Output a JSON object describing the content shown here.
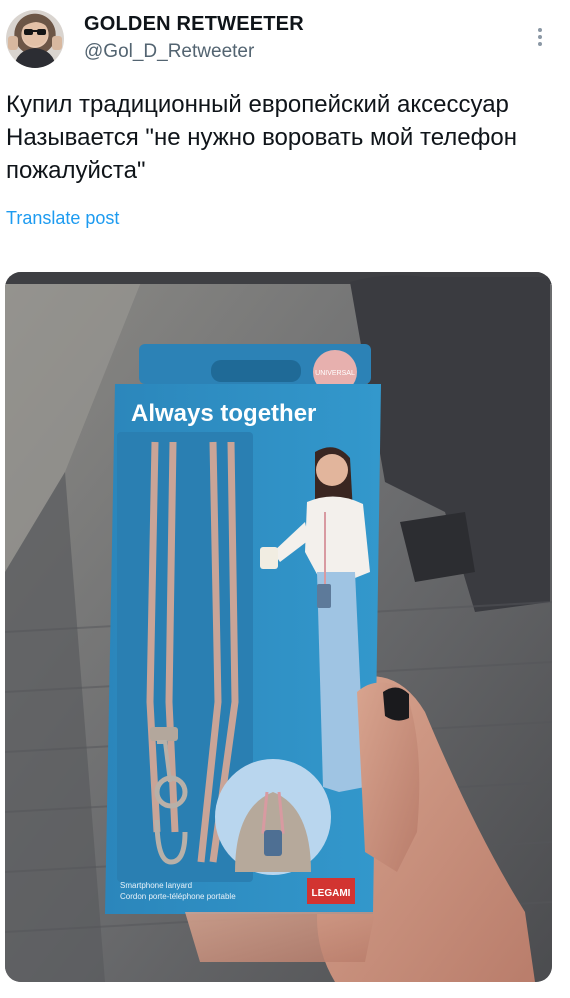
{
  "tweet": {
    "author": {
      "display_name": "GOLDEN RETWEETER",
      "handle": "@Gol_D_Retweeter"
    },
    "text": "Купил традиционный европейский аксессуар Называется \"не нужно воровать мой телефон пожалуйста\"",
    "translate_label": "Translate post",
    "media": {
      "package": {
        "badge": "UNIVERSAL",
        "title": "Always together",
        "caption_line1": "Smartphone lanyard",
        "caption_line2": "Cordon porte-téléphone portable",
        "brand": "LEGAMI"
      }
    }
  },
  "icons": {
    "more": "more-vertical-icon",
    "avatar": "avatar"
  },
  "colors": {
    "text_primary": "#0f1419",
    "text_secondary": "#536471",
    "link": "#1d9bf0",
    "package_blue": "#2f8fc2",
    "lanyard_pink": "#c7a39a",
    "brand_red": "#d23431"
  }
}
